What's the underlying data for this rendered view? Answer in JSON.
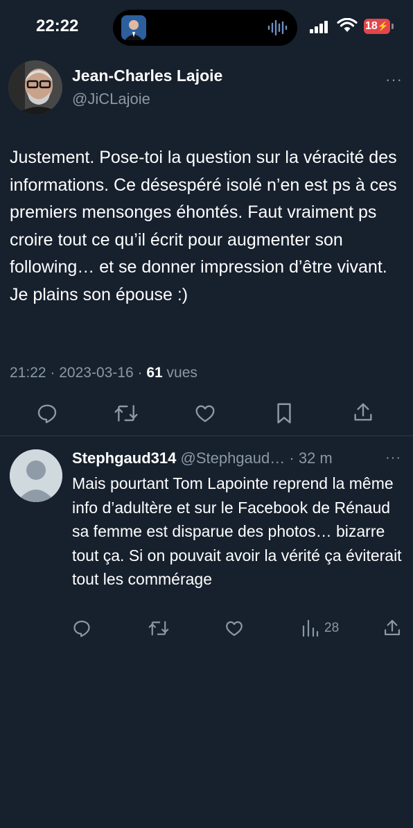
{
  "status_bar": {
    "time": "22:22",
    "battery": "18"
  },
  "tweet": {
    "author_name": "Jean-Charles Lajoie",
    "author_handle": "@JiCLajoie",
    "more": "···",
    "text": "Justement. Pose-toi la question sur la véracité des informations. Ce désespéré isolé n’en est ps à ces premiers mensonges éhontés. Faut vraiment ps croire tout ce qu’il écrit pour augmenter son following… et se donner impression d’être vivant. Je plains son épouse :)",
    "time": "21:22",
    "date": "2023-03-16",
    "views_count": "61",
    "views_label": "vues",
    "separator": " · "
  },
  "actions_main": [
    "reply-icon",
    "retweet-icon",
    "like-icon",
    "bookmark-icon",
    "share-icon"
  ],
  "reply": {
    "author_name": "Stephgaud314",
    "author_handle": "@Stephgaud…",
    "age": "· 32 m",
    "more": "···",
    "text": "Mais pourtant Tom Lapointe reprend la même info d’adultère et sur le Facebook de Rénaud sa femme est disparue des photos… bizarre tout ça. Si on pouvait avoir la vérité ça éviterait tout les commérage",
    "views_count": "28"
  },
  "colors": {
    "background": "#17202d",
    "muted": "#8b98a5",
    "text": "#ffffff",
    "battery": "#e2454a"
  }
}
